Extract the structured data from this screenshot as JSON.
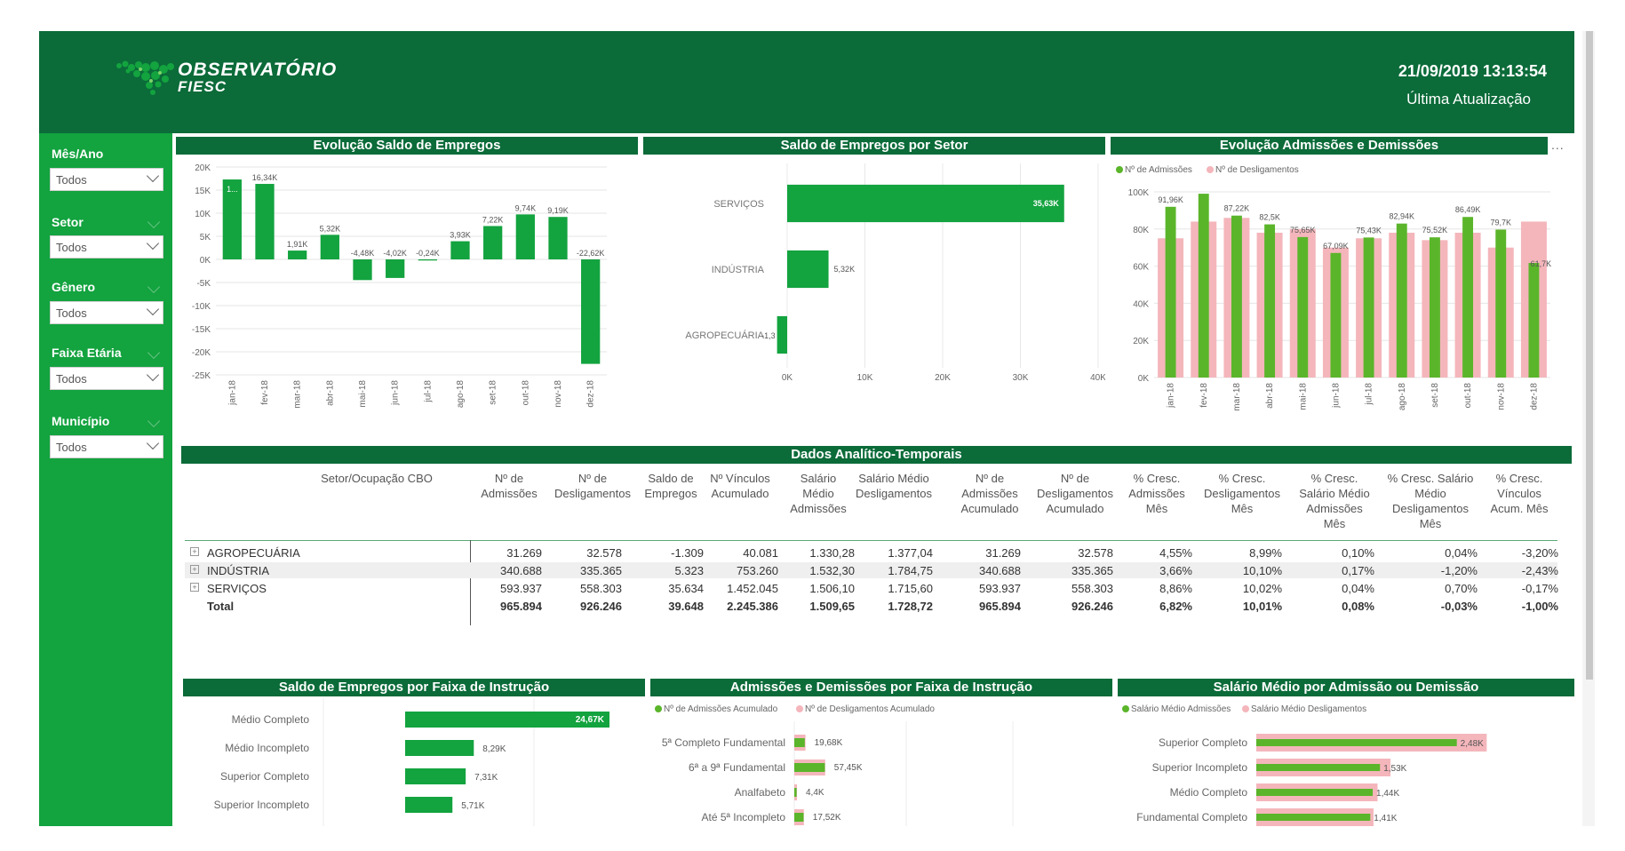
{
  "header": {
    "logo_line1": "OBSERVATÓRIO",
    "logo_line2": "FIESC",
    "datetime": "21/09/2019 13:13:54",
    "last_update_label": "Última Atualização"
  },
  "filters": [
    {
      "label": "Mês/Ano",
      "value": "Todos"
    },
    {
      "label": "Setor",
      "value": "Todos"
    },
    {
      "label": "Gênero",
      "value": "Todos"
    },
    {
      "label": "Faixa Etária",
      "value": "Todos"
    },
    {
      "label": "Município",
      "value": "Todos"
    }
  ],
  "colors": {
    "dark_green": "#0b6b39",
    "bar_green": "#13a33f",
    "lime": "#5ab52a",
    "pink": "#f4b6bb"
  },
  "titles": {
    "saldo_evolucao": "Evolução Saldo de Empregos",
    "saldo_setor": "Saldo de Empregos por Setor",
    "adm_dem": "Evolução Admissões e Demissões",
    "dados": "Dados Analítico-Temporais",
    "faixa_instrucao": "Saldo de Empregos por Faixa de Instrução",
    "adm_dem_instrucao": "Admissões e Demissões por Faixa de Instrução",
    "salario": "Salário Médio por Admissão ou Demissão"
  },
  "more_options": "...",
  "chart_data": [
    {
      "type": "bar",
      "categories": [
        "jan-18",
        "fev-18",
        "mar-18",
        "abr-18",
        "mai-18",
        "jun-18",
        "jul-18",
        "ago-18",
        "set-18",
        "out-18",
        "nov-18",
        "dez-18"
      ],
      "values": [
        17.3,
        16.34,
        1.91,
        5.32,
        -4.48,
        -4.02,
        -0.24,
        3.93,
        7.22,
        9.74,
        9.19,
        -22.62
      ],
      "data_labels": [
        "1...",
        "16,34K",
        "1,91K",
        "5,32K",
        "-4,48K",
        "-4,02K",
        "-0,24K",
        "3,93K",
        "7,22K",
        "9,74K",
        "9,19K",
        "-22,62K"
      ],
      "yticks": [
        "20K",
        "15K",
        "10K",
        "5K",
        "0K",
        "-5K",
        "-10K",
        "-15K",
        "-20K",
        "-25K"
      ],
      "ylim": [
        -25,
        20
      ]
    },
    {
      "type": "bar",
      "categories": [
        "SERVIÇOS",
        "INDÚSTRIA",
        "AGROPECUÁRIA"
      ],
      "values": [
        35.63,
        5.32,
        -1.3
      ],
      "data_labels": [
        "35,63K",
        "5,32K",
        "-1,3"
      ],
      "xticks": [
        "0K",
        "10K",
        "20K",
        "30K",
        "40K"
      ],
      "xlim": [
        0,
        40
      ]
    },
    {
      "type": "bar",
      "categories": [
        "jan-18",
        "fev-18",
        "mar-18",
        "abr-18",
        "mai-18",
        "jun-18",
        "jul-18",
        "ago-18",
        "set-18",
        "out-18",
        "nov-18",
        "dez-18"
      ],
      "series": [
        {
          "name": "Nº de Admissões",
          "values": [
            91.96,
            99,
            87.22,
            82.5,
            75.65,
            67.09,
            75.43,
            82.94,
            75.52,
            86.49,
            79.7,
            61.7
          ]
        },
        {
          "name": "Nº de Desligamentos",
          "values": [
            75,
            84,
            86,
            78,
            80,
            70,
            75,
            78,
            74,
            78,
            70,
            84
          ]
        }
      ],
      "data_labels": [
        "91,96K",
        "",
        "87,22K",
        "82,5K",
        "75,65K",
        "67,09K",
        "75,43K",
        "82,94K",
        "75,52K",
        "86,49K",
        "79,7K",
        "61,7K"
      ],
      "yticks": [
        "100K",
        "80K",
        "60K",
        "40K",
        "20K",
        "0K"
      ],
      "ylim": [
        0,
        100
      ]
    },
    {
      "type": "bar",
      "categories": [
        "Médio Completo",
        "Médio Incompleto",
        "Superior Completo",
        "Superior Incompleto"
      ],
      "values": [
        24.67,
        8.29,
        7.31,
        5.71
      ],
      "data_labels": [
        "24,67K",
        "8,29K",
        "7,31K",
        "5,71K"
      ]
    },
    {
      "type": "bar",
      "categories": [
        "5ª Completo Fundamental",
        "6ª a 9ª Fundamental",
        "Analfabeto",
        "Até 5ª Incompleto"
      ],
      "series": [
        {
          "name": "Nº de Admissões Acumulado",
          "values": [
            19.68,
            57.45,
            4.4,
            17.52
          ]
        },
        {
          "name": "Nº de Desligamentos Acumulado",
          "values": [
            21,
            58,
            5,
            18
          ]
        }
      ],
      "data_labels": [
        "19,68K",
        "57,45K",
        "4,4K",
        "17,52K"
      ]
    },
    {
      "type": "bar",
      "categories": [
        "Superior Completo",
        "Superior Incompleto",
        "Médio Completo",
        "Fundamental Completo"
      ],
      "series": [
        {
          "name": "Salário Médio Admissões",
          "values": [
            2.48,
            1.53,
            1.44,
            1.41
          ]
        },
        {
          "name": "Salário Médio Desligamentos",
          "values": [
            2.85,
            1.66,
            1.5,
            1.45
          ]
        }
      ],
      "data_labels": [
        "2,48K",
        "1,53K",
        "1,44K",
        "1,41K"
      ]
    }
  ],
  "table": {
    "headers": [
      [
        "Setor/Ocupação CBO"
      ],
      [
        "Nº de",
        "Admissões"
      ],
      [
        "Nº de",
        "Desligamentos"
      ],
      [
        "Saldo de",
        "Empregos"
      ],
      [
        "Nº Vínculos",
        "Acumulado"
      ],
      [
        "Salário",
        "Médio",
        "Admissões"
      ],
      [
        "Salário Médio",
        "Desligamentos"
      ],
      [
        "Nº de",
        "Admissões",
        "Acumulado"
      ],
      [
        "Nº de",
        "Desligamentos",
        "Acumulado"
      ],
      [
        "% Cresc.",
        "Admissões",
        "Mês"
      ],
      [
        "% Cresc.",
        "Desligamentos",
        "Mês"
      ],
      [
        "% Cresc.",
        "Salário Médio",
        "Admissões",
        "Mês"
      ],
      [
        "% Cresc. Salário",
        "Médio",
        "Desligamentos",
        "Mês"
      ],
      [
        "% Cresc.",
        "Vínculos",
        "Acum. Mês"
      ]
    ],
    "rows": [
      [
        "AGROPECUÁRIA",
        "31.269",
        "32.578",
        "-1.309",
        "40.081",
        "1.330,28",
        "1.377,04",
        "31.269",
        "32.578",
        "4,55%",
        "8,99%",
        "0,10%",
        "0,04%",
        "-3,20%"
      ],
      [
        "INDÚSTRIA",
        "340.688",
        "335.365",
        "5.323",
        "753.260",
        "1.532,30",
        "1.784,75",
        "340.688",
        "335.365",
        "3,66%",
        "10,10%",
        "0,17%",
        "-1,20%",
        "-2,43%"
      ],
      [
        "SERVIÇOS",
        "593.937",
        "558.303",
        "35.634",
        "1.452.045",
        "1.506,10",
        "1.715,60",
        "593.937",
        "558.303",
        "8,86%",
        "10,02%",
        "0,04%",
        "0,70%",
        "-0,17%"
      ]
    ],
    "total": [
      "Total",
      "965.894",
      "926.246",
      "39.648",
      "2.245.386",
      "1.509,65",
      "1.728,72",
      "965.894",
      "926.246",
      "6,82%",
      "10,01%",
      "0,08%",
      "-0,03%",
      "-1,00%"
    ]
  }
}
